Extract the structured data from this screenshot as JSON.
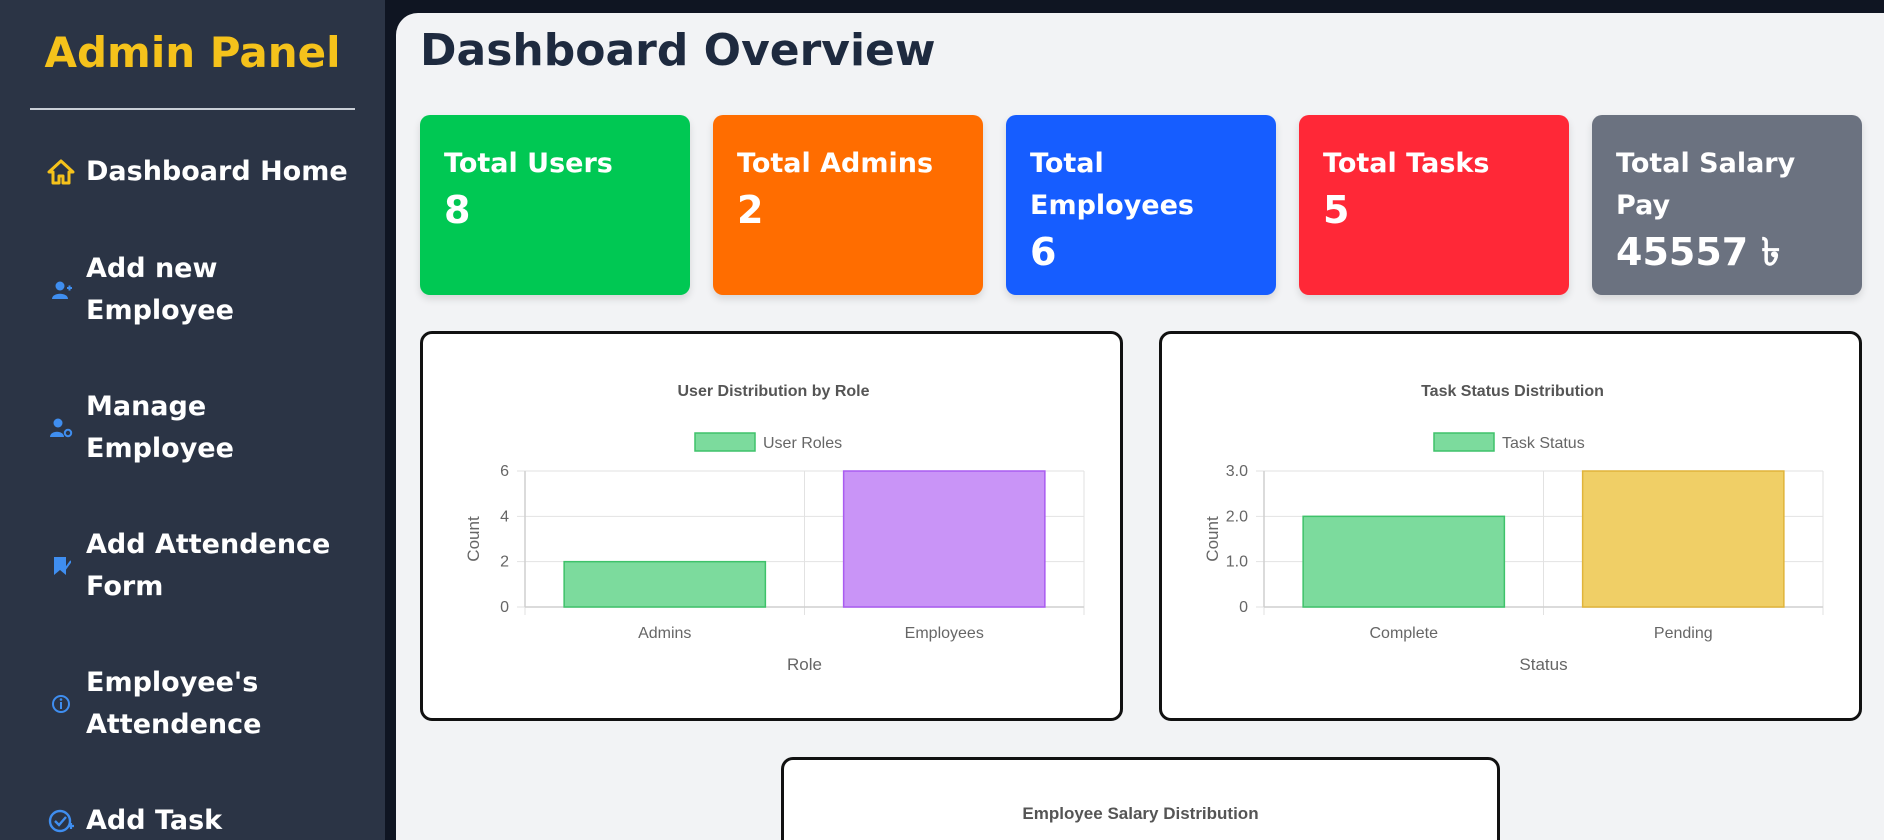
{
  "sidebar": {
    "brand": "Admin Panel",
    "items": [
      {
        "label": "Dashboard Home",
        "icon": "home-icon"
      },
      {
        "label": "Add new Employee",
        "icon": "user-add-icon"
      },
      {
        "label": "Manage Employee",
        "icon": "user-gear-icon"
      },
      {
        "label": "Add Attendence Form",
        "icon": "bookmark-check-icon"
      },
      {
        "label": "Employee's Attendence",
        "icon": "info-circle-icon"
      },
      {
        "label": "Add Task",
        "icon": "task-check-icon"
      }
    ]
  },
  "main": {
    "title": "Dashboard Overview",
    "cards": [
      {
        "label": "Total Users",
        "value": "8",
        "color": "#00c853"
      },
      {
        "label": "Total Admins",
        "value": "2",
        "color": "#ff6d00"
      },
      {
        "label": "Total Employees",
        "value": "6",
        "color": "#165dff"
      },
      {
        "label": "Total Tasks",
        "value": "5",
        "color": "#ff2837"
      },
      {
        "label": "Total Salary Pay",
        "value": "45557 ৳",
        "color": "#6b7280"
      }
    ]
  },
  "chart_data": [
    {
      "type": "bar",
      "title": "User Distribution by Role",
      "legend": "User Roles",
      "legend_position": "top",
      "categories": [
        "Admins",
        "Employees"
      ],
      "values": [
        2,
        6
      ],
      "colors": [
        "#7cdb9d",
        "#c994f7"
      ],
      "borders": [
        "#3ec26a",
        "#a95cf0"
      ],
      "xlabel": "Role",
      "ylabel": "Count",
      "ylim": [
        0,
        6
      ],
      "yticks": [
        "0",
        "2",
        "4",
        "6"
      ],
      "ytick_values": [
        0,
        2,
        4,
        6
      ],
      "grid": true
    },
    {
      "type": "bar",
      "title": "Task Status Distribution",
      "legend": "Task Status",
      "legend_position": "top",
      "categories": [
        "Complete",
        "Pending"
      ],
      "values": [
        2,
        3
      ],
      "colors": [
        "#7cdb9d",
        "#f0cf66"
      ],
      "borders": [
        "#3ec26a",
        "#e0b43a"
      ],
      "xlabel": "Status",
      "ylabel": "Count",
      "ylim": [
        0,
        3
      ],
      "yticks": [
        "0",
        "1.0",
        "2.0",
        "3.0"
      ],
      "ytick_values": [
        0,
        1,
        2,
        3
      ],
      "grid": true
    },
    {
      "type": "bar",
      "title": "Employee Salary Distribution"
    }
  ]
}
